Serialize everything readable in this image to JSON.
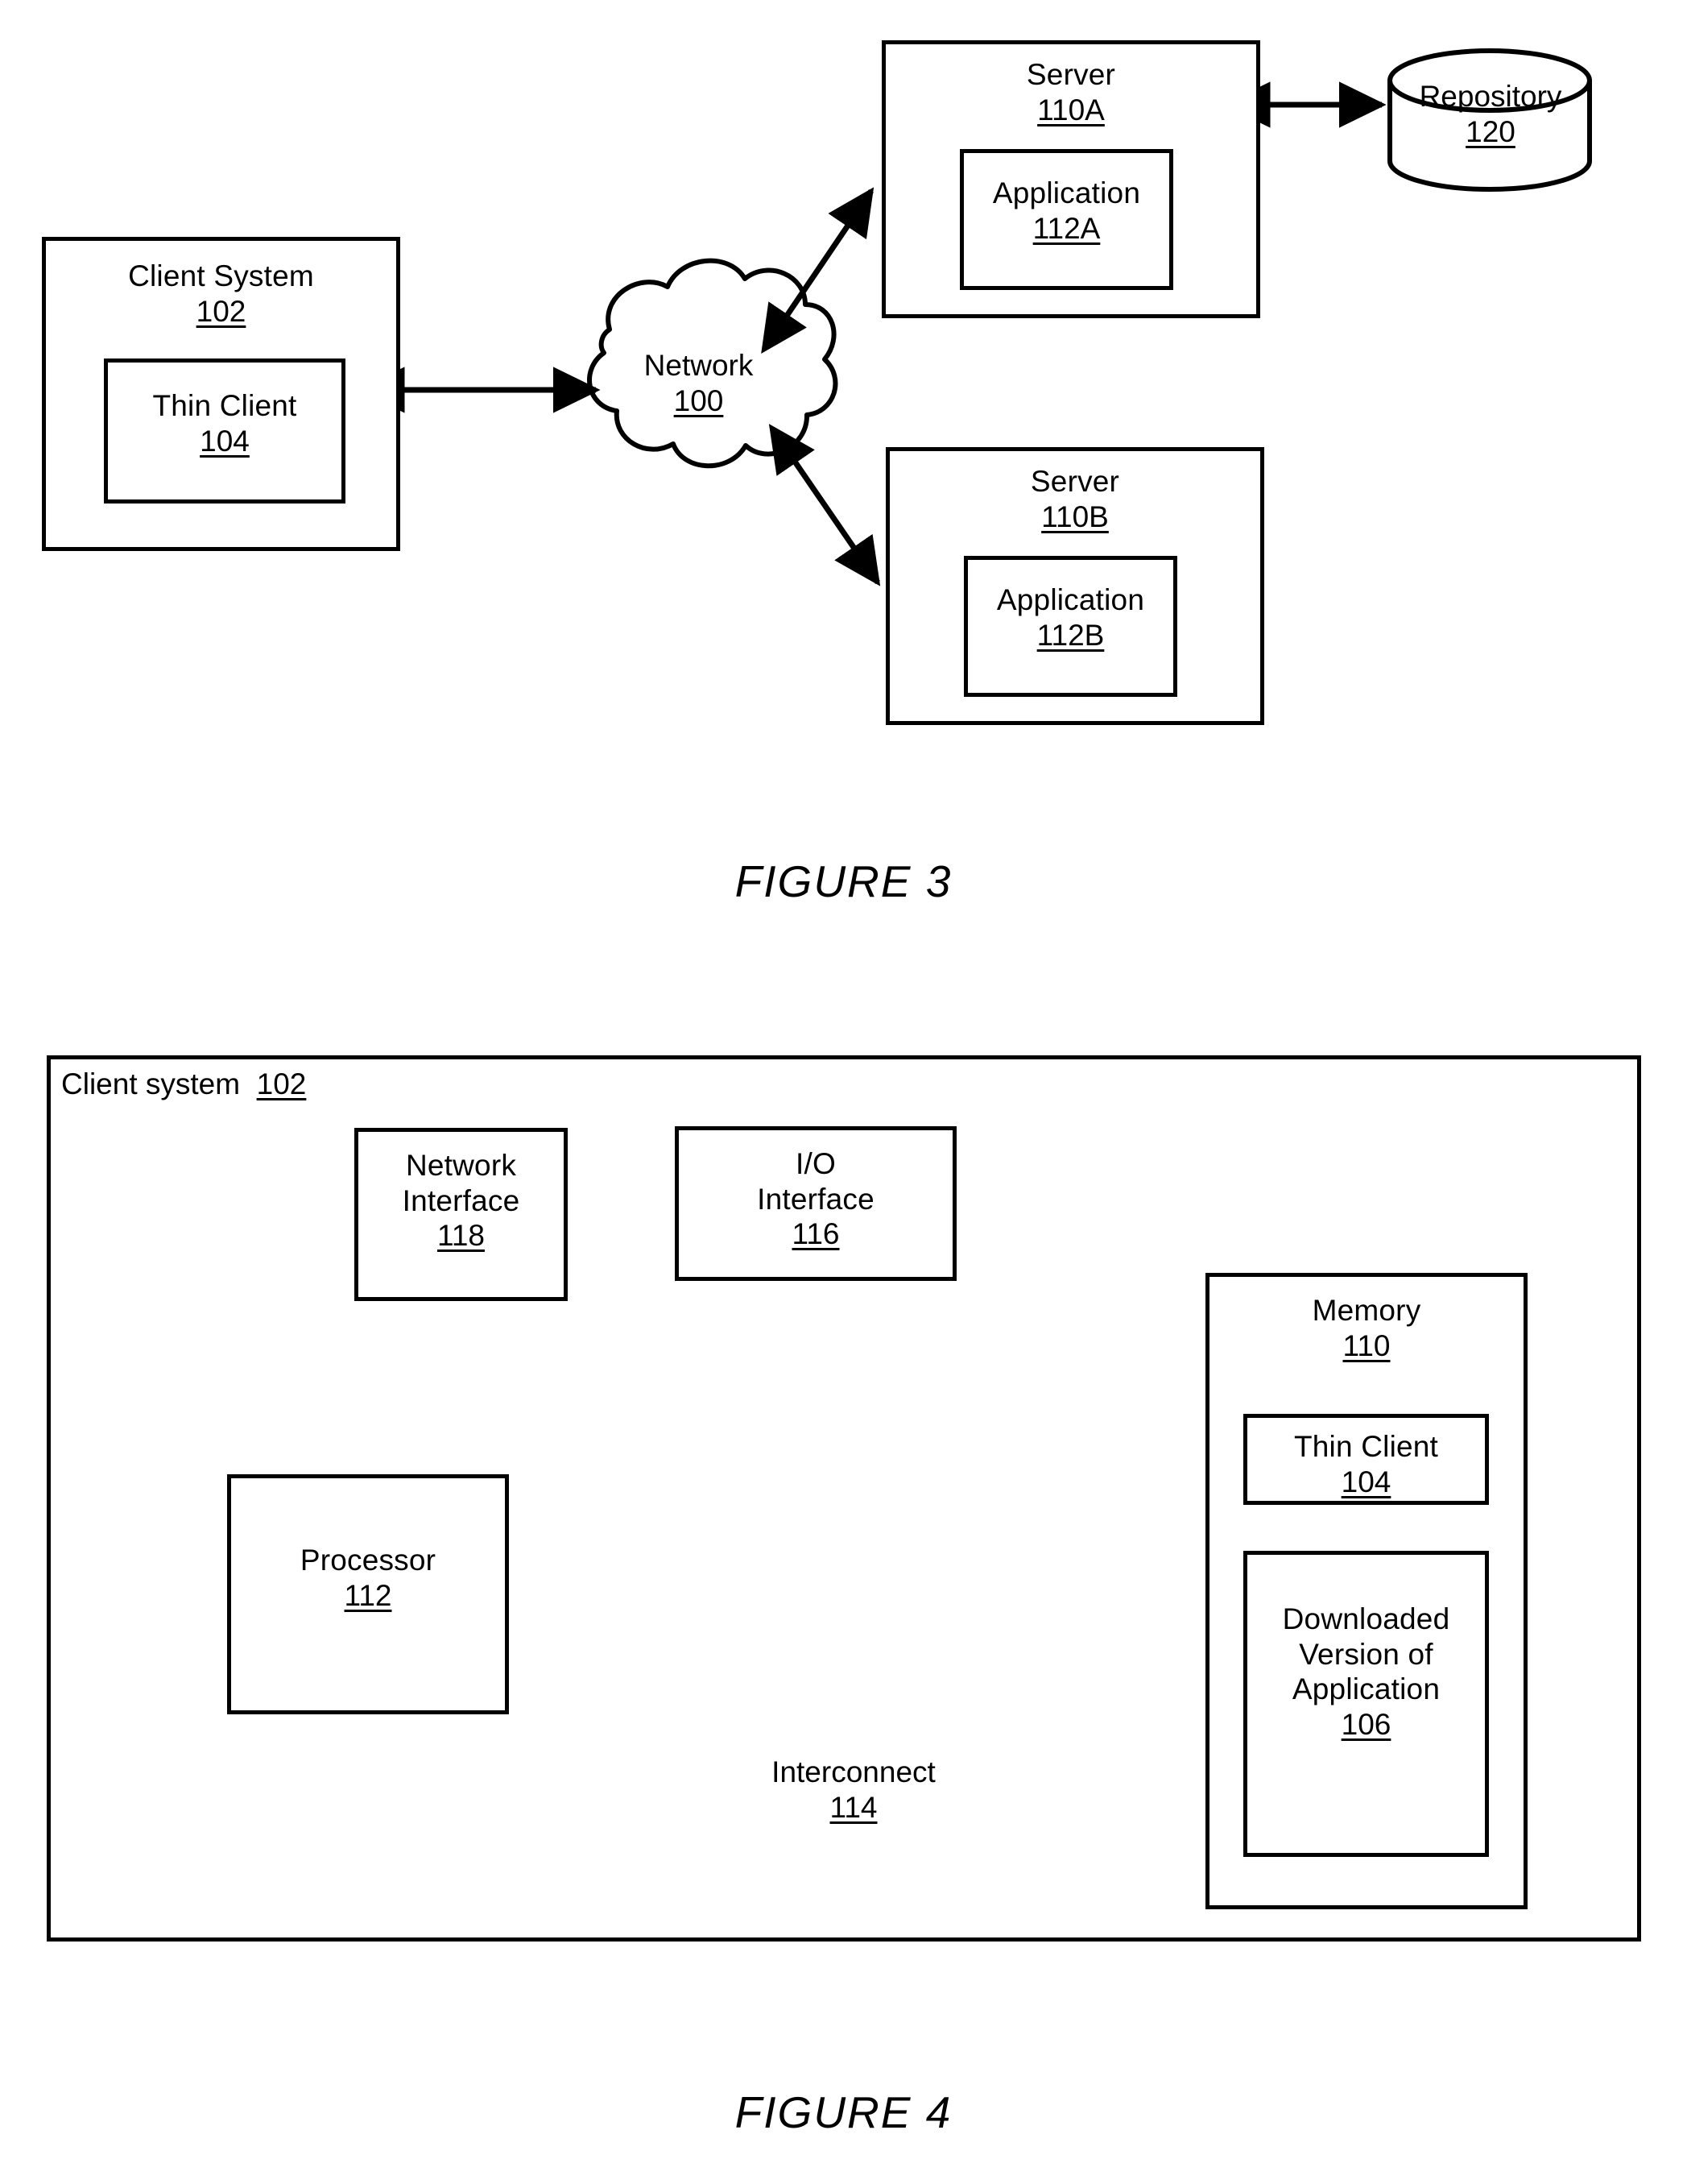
{
  "document": {
    "kind": "patent-drawing-sheet",
    "figures": [
      "FIGURE 3",
      "FIGURE 4"
    ]
  },
  "figure3": {
    "caption": "FIGURE 3",
    "client_system": {
      "title": "Client System",
      "ref": "102",
      "thin_client": {
        "title": "Thin Client",
        "ref": "104"
      }
    },
    "network": {
      "title": "Network",
      "ref": "100"
    },
    "server_a": {
      "title": "Server",
      "ref": "110A",
      "application": {
        "title": "Application",
        "ref": "112A"
      }
    },
    "server_b": {
      "title": "Server",
      "ref": "110B",
      "application": {
        "title": "Application",
        "ref": "112B"
      }
    },
    "repository": {
      "title": "Repository",
      "ref": "120"
    },
    "connections": [
      {
        "from": "Thin Client / Client System",
        "to": "Network",
        "style": "double-arrow"
      },
      {
        "from": "Network",
        "to": "Server 110A",
        "style": "double-arrow"
      },
      {
        "from": "Network",
        "to": "Server 110B",
        "style": "double-arrow"
      },
      {
        "from": "Server 110A",
        "to": "Repository 120",
        "style": "double-arrow"
      }
    ]
  },
  "figure4": {
    "caption": "FIGURE 4",
    "client_system": {
      "title": "Client system",
      "ref": "102"
    },
    "network_interface": {
      "title": "Network\nInterface",
      "ref": "118"
    },
    "io_interface": {
      "title": "I/O\nInterface",
      "ref": "116"
    },
    "processor": {
      "title": "Processor",
      "ref": "112"
    },
    "interconnect": {
      "title": "Interconnect",
      "ref": "114"
    },
    "memory": {
      "title": "Memory",
      "ref": "110",
      "thin_client": {
        "title": "Thin Client",
        "ref": "104"
      },
      "downloaded_application": {
        "title": "Downloaded\nVersion of\nApplication",
        "ref": "106"
      }
    },
    "connections": [
      {
        "from": "Network Interface 118",
        "to": "I/O Interface 116",
        "style": "line"
      },
      {
        "from": "I/O Interface 116",
        "to": "Interconnect 114",
        "style": "line"
      },
      {
        "from": "Processor 112",
        "to": "Memory 110",
        "style": "line"
      },
      {
        "from": "Thin Client 104",
        "to": "Downloaded Version of Application 106",
        "style": "line"
      },
      {
        "from": "Interconnect label 114",
        "to": "Interconnect bus",
        "style": "leader-arrow"
      }
    ]
  },
  "colors": {
    "ink": "#000000",
    "paper": "#ffffff"
  }
}
